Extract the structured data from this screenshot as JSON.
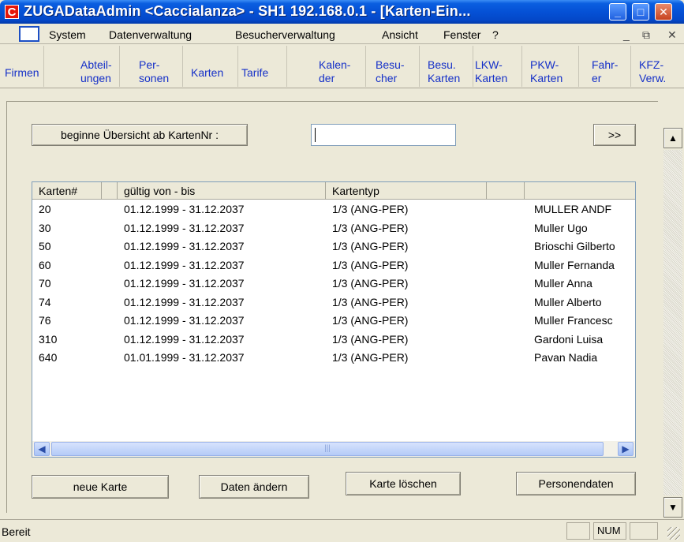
{
  "window": {
    "title": "ZUGADataAdmin <Caccialanza> - SH1 192.168.0.1 - [Karten-Ein...",
    "icon_letter": "C"
  },
  "menu": {
    "items": [
      "System",
      "Datenverwaltung",
      "Besucherverwaltung",
      "Ansicht",
      "Fenster",
      "?"
    ]
  },
  "toolbar": {
    "items": [
      {
        "lines": [
          "Firmen"
        ]
      },
      {
        "lines": [
          "Abteil-",
          "ungen"
        ]
      },
      {
        "lines": [
          "Per-",
          "sonen"
        ]
      },
      {
        "lines": [
          "Karten"
        ]
      },
      {
        "lines": [
          "Tarife"
        ]
      },
      {
        "lines": [
          "Kalen-",
          "der"
        ]
      },
      {
        "lines": [
          "Besu-",
          "cher"
        ]
      },
      {
        "lines": [
          "Besu.",
          "Karten"
        ]
      },
      {
        "lines": [
          "LKW-",
          "Karten"
        ]
      },
      {
        "lines": [
          "PKW-",
          "Karten"
        ]
      },
      {
        "lines": [
          "Fahr-",
          "er"
        ]
      },
      {
        "lines": [
          "KFZ-",
          "Verw."
        ]
      }
    ]
  },
  "overview": {
    "start_button": "beginne Übersicht ab KartenNr :",
    "cardno_value": "",
    "next_button": ">>"
  },
  "table": {
    "columns": [
      "Karten#",
      "",
      "gültig von - bis",
      "Kartentyp",
      "",
      "",
      ""
    ],
    "rows": [
      {
        "nr": "20",
        "validity": "01.12.1999 - 31.12.2037",
        "type": "1/3 (ANG-PER)",
        "name": "MULLER ANDF"
      },
      {
        "nr": "30",
        "validity": "01.12.1999 - 31.12.2037",
        "type": "1/3 (ANG-PER)",
        "name": "Muller Ugo"
      },
      {
        "nr": "50",
        "validity": "01.12.1999 - 31.12.2037",
        "type": "1/3 (ANG-PER)",
        "name": "Brioschi Gilberto"
      },
      {
        "nr": "60",
        "validity": "01.12.1999 - 31.12.2037",
        "type": "1/3 (ANG-PER)",
        "name": "Muller Fernanda"
      },
      {
        "nr": "70",
        "validity": "01.12.1999 - 31.12.2037",
        "type": "1/3 (ANG-PER)",
        "name": "Muller Anna"
      },
      {
        "nr": "74",
        "validity": "01.12.1999 - 31.12.2037",
        "type": "1/3 (ANG-PER)",
        "name": "Muller Alberto"
      },
      {
        "nr": "76",
        "validity": "01.12.1999 - 31.12.2037",
        "type": "1/3 (ANG-PER)",
        "name": "Muller Francesc"
      },
      {
        "nr": "310",
        "validity": "01.12.1999 - 31.12.2037",
        "type": "1/3 (ANG-PER)",
        "name": "Gardoni  Luisa"
      },
      {
        "nr": "640",
        "validity": "01.01.1999 - 31.12.2037",
        "type": "1/3 (ANG-PER)",
        "name": "Pavan  Nadia"
      }
    ]
  },
  "actions": {
    "new_card": "neue Karte",
    "edit_data": "Daten ändern",
    "delete_card": "Karte löschen",
    "person_data": "Personendaten"
  },
  "status": {
    "text": "Bereit",
    "num": "NUM"
  },
  "colors": {
    "title_blue": "#0551d6",
    "toolbar_link": "#1530c8",
    "face": "#ece9d8"
  }
}
